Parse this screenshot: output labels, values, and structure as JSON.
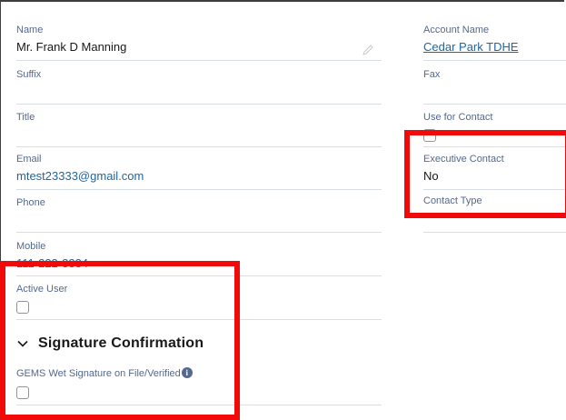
{
  "left_fields": {
    "name": {
      "label": "Name",
      "value": "Mr. Frank D Manning"
    },
    "suffix": {
      "label": "Suffix",
      "value": ""
    },
    "title": {
      "label": "Title",
      "value": ""
    },
    "email": {
      "label": "Email",
      "value": "mtest23333@gmail.com"
    },
    "phone": {
      "label": "Phone",
      "value": ""
    },
    "mobile": {
      "label": "Mobile",
      "value": "111-222-3334"
    },
    "active_user": {
      "label": "Active User",
      "checked": false
    }
  },
  "right_fields": {
    "account_name": {
      "label": "Account Name",
      "value": "Cedar Park TDHE"
    },
    "fax": {
      "label": "Fax",
      "value": ""
    },
    "use_for_contact": {
      "label": "Use for Contact",
      "checked": false
    },
    "executive_contact": {
      "label": "Executive Contact",
      "value": "No"
    },
    "contact_type": {
      "label": "Contact Type",
      "value": ""
    }
  },
  "section": {
    "title": "Signature Confirmation",
    "gems_field": {
      "label": "GEMS Wet Signature on File/Verified",
      "checked": false
    }
  },
  "colors": {
    "highlight": "#f00a0a",
    "link": "#1f66a3",
    "label": "#54698d",
    "divider": "#d8dde6"
  },
  "icons": [
    "pencil-edit-icon",
    "chevron-down-icon",
    "info-icon"
  ]
}
